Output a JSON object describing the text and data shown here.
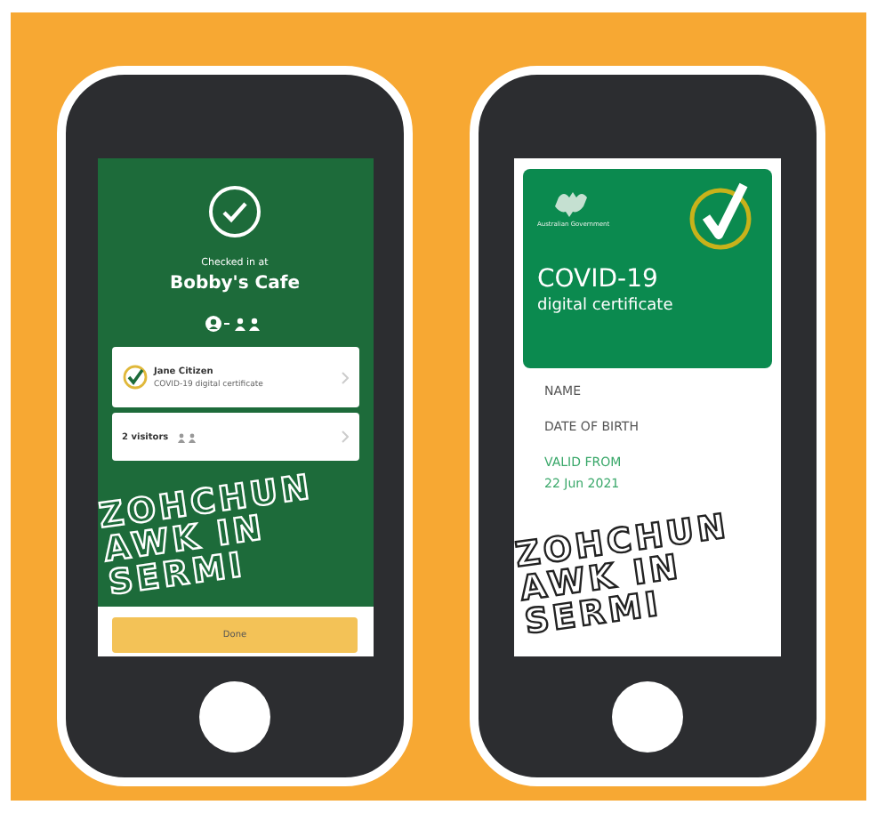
{
  "checkin_screen": {
    "heading": "Checked in at",
    "venue": "Bobby's Cafe",
    "cards": [
      {
        "kind": "certificate",
        "title": "Jane Citizen",
        "subtitle": "COVID-19 digital certificate"
      },
      {
        "kind": "visitors",
        "title": "2 visitors"
      }
    ],
    "done_button": "Done",
    "overlay": [
      "ZOHCHUN",
      "AWK IN",
      "SERMI"
    ]
  },
  "certificate_screen": {
    "issuer": "Australian Government",
    "title": "COVID-19",
    "subtitle": "digital certificate",
    "fields": [
      {
        "kind": "label",
        "text": "NAME"
      },
      {
        "kind": "label",
        "text": "DATE OF BIRTH"
      },
      {
        "kind": "valid",
        "text": "VALID FROM"
      },
      {
        "kind": "valid",
        "text": "22 Jun 2021"
      }
    ],
    "overlay": [
      "ZOHCHUN",
      "AWK IN",
      "SERMI"
    ]
  }
}
